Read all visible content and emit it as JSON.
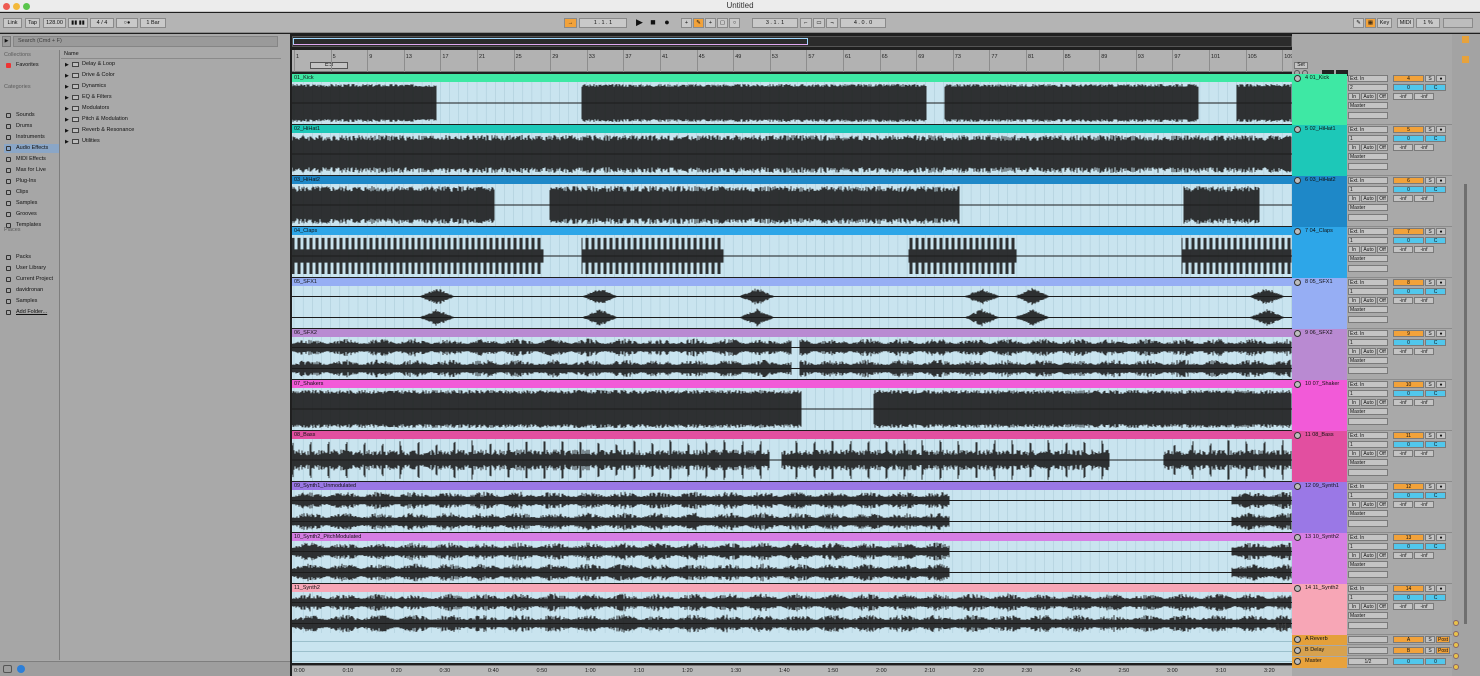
{
  "window": {
    "title": "Untitled"
  },
  "toolbar": {
    "link": "Link",
    "tap": "Tap",
    "tempo": "128.00",
    "meter": "4 / 4",
    "quantize": "1 Bar",
    "position": "1 .  1 .  1",
    "loop_start": "3 .  1 .  1",
    "loop_length": "4 .  0 .  0",
    "key": "Key",
    "midi": "MIDI",
    "cpu": "1 %",
    "h": "H",
    "w": "W"
  },
  "browser": {
    "search_placeholder": "Search (Cmd + F)",
    "collections_label": "Collections",
    "favorites": "Favorites",
    "categories_label": "Categories",
    "categories": [
      "Sounds",
      "Drums",
      "Instruments",
      "Audio Effects",
      "MIDI Effects",
      "Max for Live",
      "Plug-Ins",
      "Clips",
      "Samples",
      "Grooves",
      "Templates"
    ],
    "places_label": "Places",
    "places": [
      "Packs",
      "User Library",
      "Current Project",
      "davidronan",
      "Samples",
      "Add Folder..."
    ],
    "name_header": "Name",
    "folders": [
      "Delay & Loop",
      "Drive & Color",
      "Dynamics",
      "EQ & Filters",
      "Modulators",
      "Pitch & Modulation",
      "Reverb & Resonance",
      "Utilities"
    ]
  },
  "ruler": {
    "bars": [
      "1",
      "5",
      "9",
      "13",
      "17",
      "21",
      "25",
      "29",
      "33",
      "37",
      "41",
      "45",
      "49",
      "53",
      "57",
      "61",
      "65",
      "69",
      "73",
      "77",
      "81",
      "85",
      "89",
      "93",
      "97",
      "101",
      "105",
      "109"
    ],
    "set_label": "Set"
  },
  "tracks": [
    {
      "clip": "01_Kick",
      "name": "4 01_Kick",
      "num": "4",
      "color": "#3ee8a4",
      "sends": "2"
    },
    {
      "clip": "02_HiHat1",
      "name": "5 02_HiHat1",
      "num": "5",
      "color": "#1dc8b8",
      "sends": "1"
    },
    {
      "clip": "03_HiHat2",
      "name": "6 03_HiHat2",
      "num": "6",
      "color": "#1e88c8",
      "sends": "1"
    },
    {
      "clip": "04_Claps",
      "name": "7 04_Claps",
      "num": "7",
      "color": "#2da6e8",
      "sends": "1"
    },
    {
      "clip": "05_SFX1",
      "name": "8 05_SFX1",
      "num": "8",
      "color": "#96aef4",
      "sends": "1"
    },
    {
      "clip": "06_SFX2",
      "name": "9 06_SFX2",
      "num": "9",
      "color": "#b98ad2",
      "sends": "1"
    },
    {
      "clip": "07_Shakers",
      "name": "10 07_Shaker",
      "num": "10",
      "color": "#f25ad8",
      "sends": "1"
    },
    {
      "clip": "08_Bass",
      "name": "11 08_Bass",
      "num": "11",
      "color": "#e24fa0",
      "sends": "1"
    },
    {
      "clip": "09_Synth1_Unmodulated",
      "name": "12 09_Synth1",
      "num": "12",
      "color": "#9a78e6",
      "sends": "1"
    },
    {
      "clip": "10_Synth2_PitchModulated",
      "name": "13 10_Synth2",
      "num": "13",
      "color": "#d67ee4",
      "sends": "1"
    },
    {
      "clip": "11_Synth2",
      "name": "14 11_Synth2",
      "num": "14",
      "color": "#f7a6b6",
      "sends": "1"
    }
  ],
  "mixer_labels": {
    "input": "Ext. In",
    "in": "In",
    "auto": "Auto",
    "off": "Off",
    "output": "Master",
    "vol": "0",
    "pan": "C",
    "inf": "-inf",
    "solo": "S"
  },
  "returns": [
    {
      "name": "A Reverb",
      "letter": "A",
      "post": "Post"
    },
    {
      "name": "B Delay",
      "letter": "B",
      "post": "Post"
    }
  ],
  "master": {
    "name": "Master",
    "cue": "1/2",
    "vol": "0",
    "pan": "0"
  },
  "timeline": [
    "0:00",
    "0:10",
    "0:20",
    "0:30",
    "0:40",
    "0:50",
    "1:00",
    "1:10",
    "1:20",
    "1:30",
    "1:40",
    "1:50",
    "2:00",
    "2:10",
    "2:20",
    "2:30",
    "2:40",
    "2:50",
    "3:00",
    "3:10",
    "3:20"
  ],
  "arrangement_position": "1/1"
}
